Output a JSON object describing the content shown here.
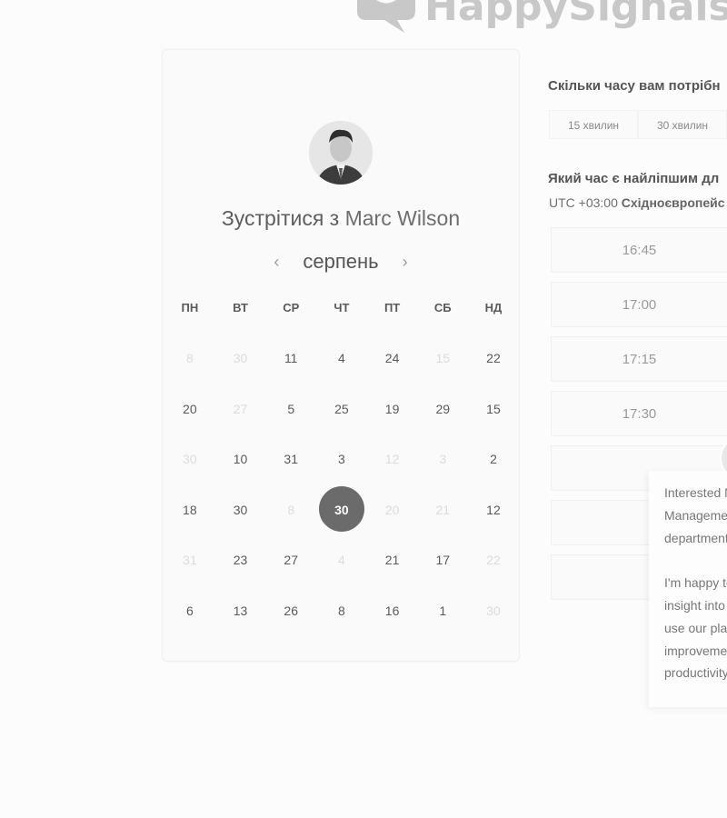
{
  "logo": {
    "text": "HappySignals"
  },
  "calendar": {
    "title_prefix": "Зустрітися з ",
    "host_name": "Marc Wilson",
    "month": "серпень",
    "prev_icon": "chevron-left-icon",
    "next_icon": "chevron-right-icon",
    "weekdays": [
      "ПН",
      "ВТ",
      "СР",
      "ЧТ",
      "ПТ",
      "СБ",
      "НД"
    ],
    "weeks": [
      [
        {
          "d": "8",
          "m": true
        },
        {
          "d": "30",
          "m": true
        },
        {
          "d": "11"
        },
        {
          "d": "4"
        },
        {
          "d": "24"
        },
        {
          "d": "15",
          "m": true
        },
        {
          "d": "22"
        }
      ],
      [
        {
          "d": "20"
        },
        {
          "d": "27",
          "m": true
        },
        {
          "d": "5"
        },
        {
          "d": "25"
        },
        {
          "d": "19"
        },
        {
          "d": "29"
        },
        {
          "d": "15"
        }
      ],
      [
        {
          "d": "30",
          "m": true
        },
        {
          "d": "10"
        },
        {
          "d": "31"
        },
        {
          "d": "3"
        },
        {
          "d": "12",
          "m": true
        },
        {
          "d": "3",
          "m": true
        },
        {
          "d": "2"
        }
      ],
      [
        {
          "d": "18"
        },
        {
          "d": "30"
        },
        {
          "d": "8",
          "m": true
        },
        {
          "d": "30",
          "s": true
        },
        {
          "d": "20",
          "m": true
        },
        {
          "d": "21",
          "m": true
        },
        {
          "d": "12"
        }
      ],
      [
        {
          "d": "31",
          "m": true
        },
        {
          "d": "23"
        },
        {
          "d": "27"
        },
        {
          "d": "4",
          "m": true
        },
        {
          "d": "21"
        },
        {
          "d": "17"
        },
        {
          "d": "22",
          "m": true
        }
      ],
      [
        {
          "d": "6"
        },
        {
          "d": "13"
        },
        {
          "d": "26"
        },
        {
          "d": "8"
        },
        {
          "d": "16"
        },
        {
          "d": "1"
        },
        {
          "d": "30",
          "m": true
        }
      ]
    ]
  },
  "duration": {
    "question": "Скільки часу вам потрібн",
    "options": [
      "15 хвилин",
      "30 хвилин"
    ]
  },
  "time": {
    "question": "Який час є найліпшим дл",
    "tz_offset": "UTC +03:00 ",
    "tz_name": "Східноєвропейс",
    "slots": [
      "16:45",
      "17:00",
      "17:15",
      "17:30",
      "",
      "",
      ""
    ]
  },
  "chat": {
    "lines1": [
      "Interested N",
      "Manageme",
      "department"
    ],
    "lines2": [
      "I'm happy to",
      "insight into",
      "use our pla",
      "improveme",
      "productivity"
    ]
  }
}
